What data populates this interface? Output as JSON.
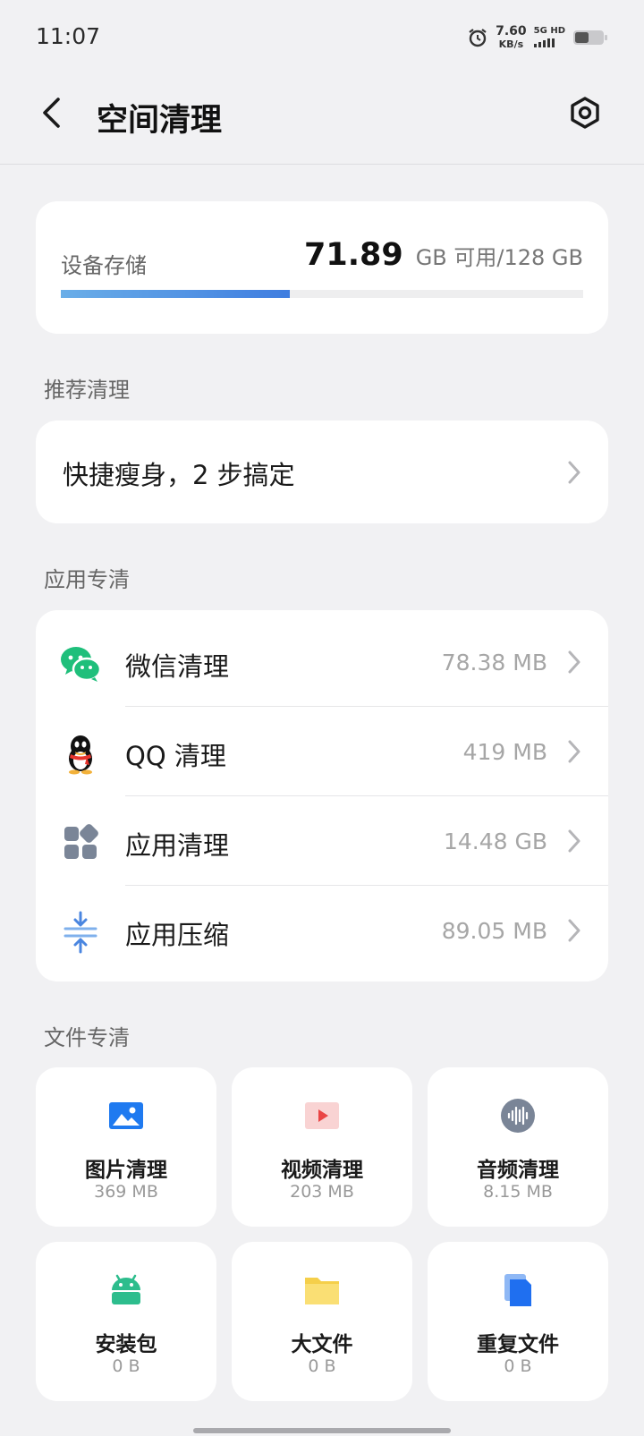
{
  "status_bar": {
    "time": "11:07",
    "speed_value": "7.60",
    "speed_unit": "KB/s",
    "network": "5G HD"
  },
  "header": {
    "title": "空间清理",
    "back_icon": "chevron-left-icon",
    "settings_icon": "gear-icon"
  },
  "storage": {
    "label": "设备存储",
    "free": "71.89",
    "free_unit": "GB 可用",
    "total": "/128 GB",
    "used_fraction": 0.438,
    "bar_colors": [
      "#6aaee8",
      "#3f7de0"
    ]
  },
  "recommend": {
    "section_title": "推荐清理",
    "item_label": "快捷瘦身，2 步搞定"
  },
  "app_clean": {
    "section_title": "应用专清",
    "items": [
      {
        "label": "微信清理",
        "size": "78.38 MB",
        "icon": "wechat-icon"
      },
      {
        "label": "QQ 清理",
        "size": "419 MB",
        "icon": "qq-icon"
      },
      {
        "label": "应用清理",
        "size": "14.48 GB",
        "icon": "apps-icon"
      },
      {
        "label": "应用压缩",
        "size": "89.05 MB",
        "icon": "compress-icon"
      }
    ]
  },
  "file_clean": {
    "section_title": "文件专清",
    "tiles": [
      {
        "label": "图片清理",
        "size": "369 MB",
        "icon": "image-icon"
      },
      {
        "label": "视频清理",
        "size": "203 MB",
        "icon": "video-icon"
      },
      {
        "label": "音频清理",
        "size": "8.15 MB",
        "icon": "audio-icon"
      },
      {
        "label": "安装包",
        "size": "0 B",
        "icon": "android-icon"
      },
      {
        "label": "大文件",
        "size": "0 B",
        "icon": "folder-icon"
      },
      {
        "label": "重复文件",
        "size": "0 B",
        "icon": "duplicate-file-icon"
      }
    ]
  }
}
